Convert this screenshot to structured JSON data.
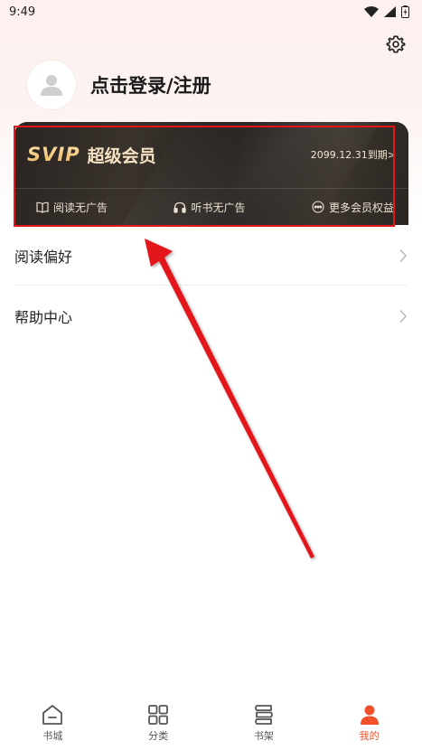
{
  "status_bar": {
    "time": "9:49"
  },
  "profile": {
    "login_text": "点击登录/注册"
  },
  "vip_card": {
    "logo_text": "SVIP",
    "title": "超级会员",
    "expire_text": "2099.12.31到期>",
    "benefits": [
      {
        "label": "阅读无广告",
        "icon": "book-icon"
      },
      {
        "label": "听书无广告",
        "icon": "headphones-icon"
      },
      {
        "label": "更多会员权益",
        "icon": "more-icon"
      }
    ]
  },
  "menu": [
    {
      "label": "阅读偏好"
    },
    {
      "label": "帮助中心"
    }
  ],
  "tabs": [
    {
      "label": "书城",
      "icon": "home-icon"
    },
    {
      "label": "分类",
      "icon": "grid-icon"
    },
    {
      "label": "书架",
      "icon": "bookshelf-icon"
    },
    {
      "label": "我的",
      "icon": "person-icon",
      "active": true
    }
  ],
  "colors": {
    "accent": "#f0512a",
    "annotation_red": "#e3161c",
    "vip_gold": "#f2c779",
    "vip_bg": "#2a2522"
  }
}
